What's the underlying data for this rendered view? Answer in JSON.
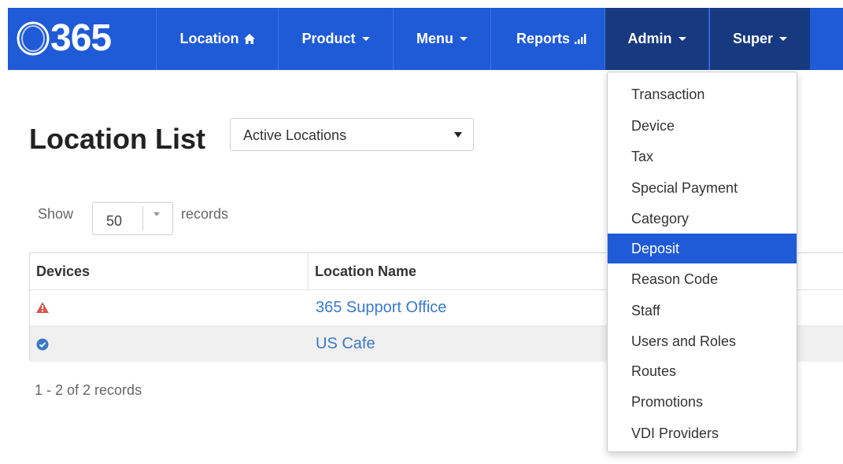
{
  "brand": {
    "logo_text": "365"
  },
  "nav": {
    "location": "Location",
    "product": "Product",
    "menu": "Menu",
    "reports": "Reports",
    "admin": "Admin",
    "super": "Super"
  },
  "colors": {
    "primary": "#1f5bd6",
    "nav_active": "#17397f",
    "link": "#3a78c9",
    "warning": "#d9534f",
    "ok": "#3a78c9"
  },
  "page": {
    "title": "Location List",
    "filter_value": "Active Locations",
    "show_label": "Show",
    "page_size": "50",
    "records_label": "records",
    "footer": "1 - 2 of 2 records"
  },
  "table": {
    "headers": [
      "Devices",
      "Location Name"
    ],
    "rows": [
      {
        "device_icon": "warning-triangle-icon",
        "name": "365 Support Office"
      },
      {
        "device_icon": "check-circle-icon",
        "name": "US Cafe"
      }
    ]
  },
  "admin_menu": {
    "items": [
      "Transaction",
      "Device",
      "Tax",
      "Special Payment",
      "Category",
      "Deposit",
      "Reason Code",
      "Staff",
      "Users and Roles",
      "Routes",
      "Promotions",
      "VDI Providers"
    ],
    "active": "Deposit"
  }
}
